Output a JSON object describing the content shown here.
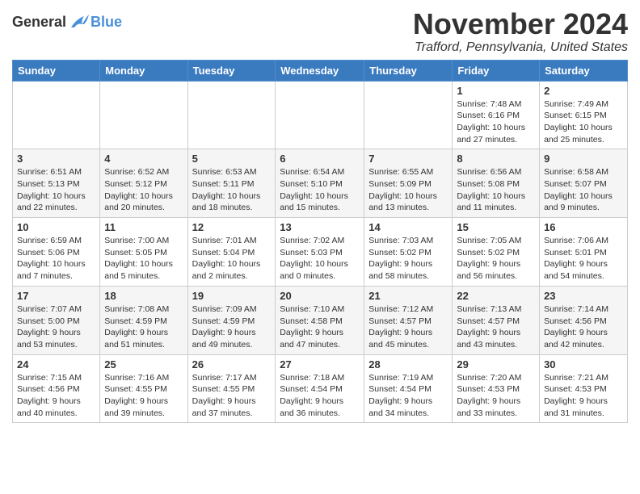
{
  "logo": {
    "general": "General",
    "blue": "Blue"
  },
  "title": "November 2024",
  "location": "Trafford, Pennsylvania, United States",
  "weekdays": [
    "Sunday",
    "Monday",
    "Tuesday",
    "Wednesday",
    "Thursday",
    "Friday",
    "Saturday"
  ],
  "weeks": [
    [
      {
        "day": "",
        "info": ""
      },
      {
        "day": "",
        "info": ""
      },
      {
        "day": "",
        "info": ""
      },
      {
        "day": "",
        "info": ""
      },
      {
        "day": "",
        "info": ""
      },
      {
        "day": "1",
        "info": "Sunrise: 7:48 AM\nSunset: 6:16 PM\nDaylight: 10 hours\nand 27 minutes."
      },
      {
        "day": "2",
        "info": "Sunrise: 7:49 AM\nSunset: 6:15 PM\nDaylight: 10 hours\nand 25 minutes."
      }
    ],
    [
      {
        "day": "3",
        "info": "Sunrise: 6:51 AM\nSunset: 5:13 PM\nDaylight: 10 hours\nand 22 minutes."
      },
      {
        "day": "4",
        "info": "Sunrise: 6:52 AM\nSunset: 5:12 PM\nDaylight: 10 hours\nand 20 minutes."
      },
      {
        "day": "5",
        "info": "Sunrise: 6:53 AM\nSunset: 5:11 PM\nDaylight: 10 hours\nand 18 minutes."
      },
      {
        "day": "6",
        "info": "Sunrise: 6:54 AM\nSunset: 5:10 PM\nDaylight: 10 hours\nand 15 minutes."
      },
      {
        "day": "7",
        "info": "Sunrise: 6:55 AM\nSunset: 5:09 PM\nDaylight: 10 hours\nand 13 minutes."
      },
      {
        "day": "8",
        "info": "Sunrise: 6:56 AM\nSunset: 5:08 PM\nDaylight: 10 hours\nand 11 minutes."
      },
      {
        "day": "9",
        "info": "Sunrise: 6:58 AM\nSunset: 5:07 PM\nDaylight: 10 hours\nand 9 minutes."
      }
    ],
    [
      {
        "day": "10",
        "info": "Sunrise: 6:59 AM\nSunset: 5:06 PM\nDaylight: 10 hours\nand 7 minutes."
      },
      {
        "day": "11",
        "info": "Sunrise: 7:00 AM\nSunset: 5:05 PM\nDaylight: 10 hours\nand 5 minutes."
      },
      {
        "day": "12",
        "info": "Sunrise: 7:01 AM\nSunset: 5:04 PM\nDaylight: 10 hours\nand 2 minutes."
      },
      {
        "day": "13",
        "info": "Sunrise: 7:02 AM\nSunset: 5:03 PM\nDaylight: 10 hours\nand 0 minutes."
      },
      {
        "day": "14",
        "info": "Sunrise: 7:03 AM\nSunset: 5:02 PM\nDaylight: 9 hours\nand 58 minutes."
      },
      {
        "day": "15",
        "info": "Sunrise: 7:05 AM\nSunset: 5:02 PM\nDaylight: 9 hours\nand 56 minutes."
      },
      {
        "day": "16",
        "info": "Sunrise: 7:06 AM\nSunset: 5:01 PM\nDaylight: 9 hours\nand 54 minutes."
      }
    ],
    [
      {
        "day": "17",
        "info": "Sunrise: 7:07 AM\nSunset: 5:00 PM\nDaylight: 9 hours\nand 53 minutes."
      },
      {
        "day": "18",
        "info": "Sunrise: 7:08 AM\nSunset: 4:59 PM\nDaylight: 9 hours\nand 51 minutes."
      },
      {
        "day": "19",
        "info": "Sunrise: 7:09 AM\nSunset: 4:59 PM\nDaylight: 9 hours\nand 49 minutes."
      },
      {
        "day": "20",
        "info": "Sunrise: 7:10 AM\nSunset: 4:58 PM\nDaylight: 9 hours\nand 47 minutes."
      },
      {
        "day": "21",
        "info": "Sunrise: 7:12 AM\nSunset: 4:57 PM\nDaylight: 9 hours\nand 45 minutes."
      },
      {
        "day": "22",
        "info": "Sunrise: 7:13 AM\nSunset: 4:57 PM\nDaylight: 9 hours\nand 43 minutes."
      },
      {
        "day": "23",
        "info": "Sunrise: 7:14 AM\nSunset: 4:56 PM\nDaylight: 9 hours\nand 42 minutes."
      }
    ],
    [
      {
        "day": "24",
        "info": "Sunrise: 7:15 AM\nSunset: 4:56 PM\nDaylight: 9 hours\nand 40 minutes."
      },
      {
        "day": "25",
        "info": "Sunrise: 7:16 AM\nSunset: 4:55 PM\nDaylight: 9 hours\nand 39 minutes."
      },
      {
        "day": "26",
        "info": "Sunrise: 7:17 AM\nSunset: 4:55 PM\nDaylight: 9 hours\nand 37 minutes."
      },
      {
        "day": "27",
        "info": "Sunrise: 7:18 AM\nSunset: 4:54 PM\nDaylight: 9 hours\nand 36 minutes."
      },
      {
        "day": "28",
        "info": "Sunrise: 7:19 AM\nSunset: 4:54 PM\nDaylight: 9 hours\nand 34 minutes."
      },
      {
        "day": "29",
        "info": "Sunrise: 7:20 AM\nSunset: 4:53 PM\nDaylight: 9 hours\nand 33 minutes."
      },
      {
        "day": "30",
        "info": "Sunrise: 7:21 AM\nSunset: 4:53 PM\nDaylight: 9 hours\nand 31 minutes."
      }
    ]
  ]
}
